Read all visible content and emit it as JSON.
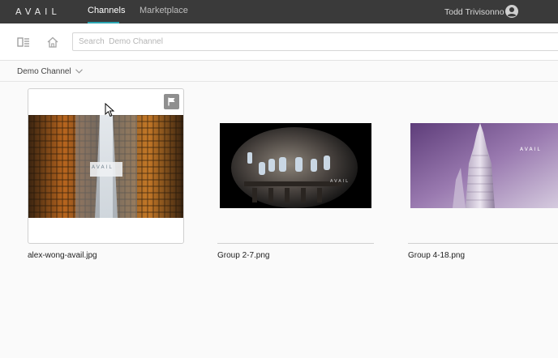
{
  "header": {
    "logo": "AVAIL",
    "tabs": [
      {
        "label": "Channels",
        "active": true
      },
      {
        "label": "Marketplace",
        "active": false
      }
    ],
    "user_name": "Todd Trivisonno",
    "accent_color": "#2ba6b3"
  },
  "toolbar": {
    "search_placeholder": "Search  Demo Channel"
  },
  "breadcrumb": {
    "channel": "Demo Channel"
  },
  "assets": [
    {
      "name": "alex-wong-avail.jpg",
      "watermark": "AVAIL",
      "selected": true
    },
    {
      "name": "Group 2-7.png",
      "watermark": "AVAIL",
      "selected": false
    },
    {
      "name": "Group 4-18.png",
      "watermark": "AVAIL",
      "selected": false
    }
  ],
  "icons": {
    "sidebar": "sidebar-toggle-icon",
    "home": "home-icon",
    "user": "user-avatar-icon",
    "flag": "flag-icon",
    "chevron": "chevron-down-icon"
  }
}
